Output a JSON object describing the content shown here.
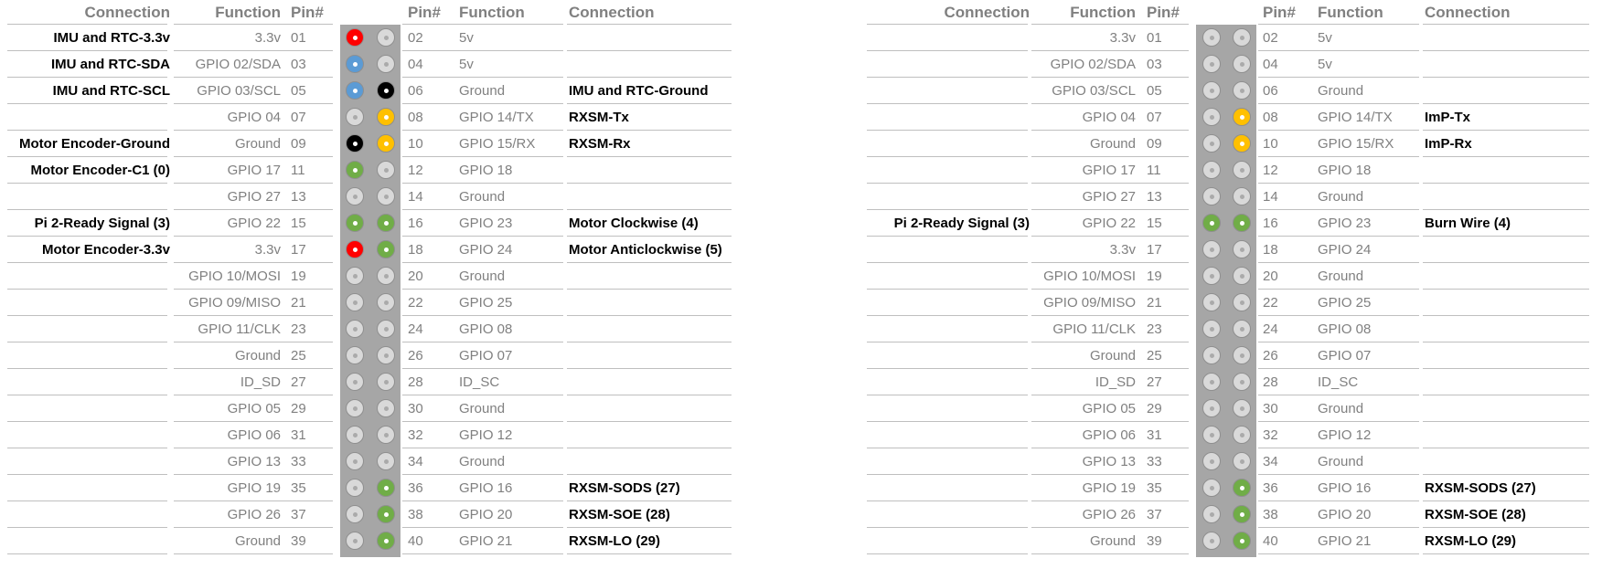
{
  "headers": {
    "connection": "Connection",
    "function": "Function",
    "pin": "Pin#"
  },
  "colors": {
    "white": "#d9d9d9",
    "red": "#ff0000",
    "blue": "#5b9bd5",
    "black": "#000000",
    "yellow": "#ffc000",
    "green": "#70ad47"
  },
  "left_panel": {
    "rows": [
      {
        "lconn": "IMU and RTC-3.3v",
        "lfunc": "3.3v",
        "lpin": "01",
        "lcolor": "red",
        "rcolor": "white",
        "rpin": "02",
        "rfunc": "5v",
        "rconn": ""
      },
      {
        "lconn": "IMU and RTC-SDA",
        "lfunc": "GPIO 02/SDA",
        "lpin": "03",
        "lcolor": "blue",
        "rcolor": "white",
        "rpin": "04",
        "rfunc": "5v",
        "rconn": ""
      },
      {
        "lconn": "IMU and RTC-SCL",
        "lfunc": "GPIO 03/SCL",
        "lpin": "05",
        "lcolor": "blue",
        "rcolor": "black",
        "rpin": "06",
        "rfunc": "Ground",
        "rconn": "IMU and RTC-Ground"
      },
      {
        "lconn": "",
        "lfunc": "GPIO 04",
        "lpin": "07",
        "lcolor": "white",
        "rcolor": "yellow",
        "rpin": "08",
        "rfunc": "GPIO 14/TX",
        "rconn": "RXSM-Tx"
      },
      {
        "lconn": "Motor Encoder-Ground",
        "lfunc": "Ground",
        "lpin": "09",
        "lcolor": "black",
        "rcolor": "yellow",
        "rpin": "10",
        "rfunc": "GPIO 15/RX",
        "rconn": "RXSM-Rx"
      },
      {
        "lconn": "Motor Encoder-C1 (0)",
        "lfunc": "GPIO 17",
        "lpin": "11",
        "lcolor": "green",
        "rcolor": "white",
        "rpin": "12",
        "rfunc": "GPIO 18",
        "rconn": ""
      },
      {
        "lconn": "",
        "lfunc": "GPIO 27",
        "lpin": "13",
        "lcolor": "white",
        "rcolor": "white",
        "rpin": "14",
        "rfunc": "Ground",
        "rconn": ""
      },
      {
        "lconn": "Pi 2-Ready Signal (3)",
        "lfunc": "GPIO 22",
        "lpin": "15",
        "lcolor": "green",
        "rcolor": "green",
        "rpin": "16",
        "rfunc": "GPIO 23",
        "rconn": "Motor Clockwise (4)"
      },
      {
        "lconn": "Motor Encoder-3.3v",
        "lfunc": "3.3v",
        "lpin": "17",
        "lcolor": "red",
        "rcolor": "green",
        "rpin": "18",
        "rfunc": "GPIO 24",
        "rconn": "Motor Anticlockwise (5)"
      },
      {
        "lconn": "",
        "lfunc": "GPIO 10/MOSI",
        "lpin": "19",
        "lcolor": "white",
        "rcolor": "white",
        "rpin": "20",
        "rfunc": "Ground",
        "rconn": ""
      },
      {
        "lconn": "",
        "lfunc": "GPIO 09/MISO",
        "lpin": "21",
        "lcolor": "white",
        "rcolor": "white",
        "rpin": "22",
        "rfunc": "GPIO 25",
        "rconn": ""
      },
      {
        "lconn": "",
        "lfunc": "GPIO 11/CLK",
        "lpin": "23",
        "lcolor": "white",
        "rcolor": "white",
        "rpin": "24",
        "rfunc": "GPIO 08",
        "rconn": ""
      },
      {
        "lconn": "",
        "lfunc": "Ground",
        "lpin": "25",
        "lcolor": "white",
        "rcolor": "white",
        "rpin": "26",
        "rfunc": "GPIO 07",
        "rconn": ""
      },
      {
        "lconn": "",
        "lfunc": "ID_SD",
        "lpin": "27",
        "lcolor": "white",
        "rcolor": "white",
        "rpin": "28",
        "rfunc": "ID_SC",
        "rconn": ""
      },
      {
        "lconn": "",
        "lfunc": "GPIO 05",
        "lpin": "29",
        "lcolor": "white",
        "rcolor": "white",
        "rpin": "30",
        "rfunc": "Ground",
        "rconn": ""
      },
      {
        "lconn": "",
        "lfunc": "GPIO 06",
        "lpin": "31",
        "lcolor": "white",
        "rcolor": "white",
        "rpin": "32",
        "rfunc": "GPIO 12",
        "rconn": ""
      },
      {
        "lconn": "",
        "lfunc": "GPIO 13",
        "lpin": "33",
        "lcolor": "white",
        "rcolor": "white",
        "rpin": "34",
        "rfunc": "Ground",
        "rconn": ""
      },
      {
        "lconn": "",
        "lfunc": "GPIO 19",
        "lpin": "35",
        "lcolor": "white",
        "rcolor": "green",
        "rpin": "36",
        "rfunc": "GPIO 16",
        "rconn": "RXSM-SODS (27)"
      },
      {
        "lconn": "",
        "lfunc": "GPIO 26",
        "lpin": "37",
        "lcolor": "white",
        "rcolor": "green",
        "rpin": "38",
        "rfunc": "GPIO 20",
        "rconn": "RXSM-SOE (28)"
      },
      {
        "lconn": "",
        "lfunc": "Ground",
        "lpin": "39",
        "lcolor": "white",
        "rcolor": "green",
        "rpin": "40",
        "rfunc": "GPIO 21",
        "rconn": "RXSM-LO (29)"
      }
    ]
  },
  "right_panel": {
    "rows": [
      {
        "lconn": "",
        "lfunc": "3.3v",
        "lpin": "01",
        "lcolor": "white",
        "rcolor": "white",
        "rpin": "02",
        "rfunc": "5v",
        "rconn": ""
      },
      {
        "lconn": "",
        "lfunc": "GPIO 02/SDA",
        "lpin": "03",
        "lcolor": "white",
        "rcolor": "white",
        "rpin": "04",
        "rfunc": "5v",
        "rconn": ""
      },
      {
        "lconn": "",
        "lfunc": "GPIO 03/SCL",
        "lpin": "05",
        "lcolor": "white",
        "rcolor": "white",
        "rpin": "06",
        "rfunc": "Ground",
        "rconn": ""
      },
      {
        "lconn": "",
        "lfunc": "GPIO 04",
        "lpin": "07",
        "lcolor": "white",
        "rcolor": "yellow",
        "rpin": "08",
        "rfunc": "GPIO 14/TX",
        "rconn": "ImP-Tx"
      },
      {
        "lconn": "",
        "lfunc": "Ground",
        "lpin": "09",
        "lcolor": "white",
        "rcolor": "yellow",
        "rpin": "10",
        "rfunc": "GPIO 15/RX",
        "rconn": "ImP-Rx"
      },
      {
        "lconn": "",
        "lfunc": "GPIO 17",
        "lpin": "11",
        "lcolor": "white",
        "rcolor": "white",
        "rpin": "12",
        "rfunc": "GPIO 18",
        "rconn": ""
      },
      {
        "lconn": "",
        "lfunc": "GPIO 27",
        "lpin": "13",
        "lcolor": "white",
        "rcolor": "white",
        "rpin": "14",
        "rfunc": "Ground",
        "rconn": ""
      },
      {
        "lconn": "Pi 2-Ready Signal (3)",
        "lfunc": "GPIO 22",
        "lpin": "15",
        "lcolor": "green",
        "rcolor": "green",
        "rpin": "16",
        "rfunc": "GPIO 23",
        "rconn": "Burn Wire (4)"
      },
      {
        "lconn": "",
        "lfunc": "3.3v",
        "lpin": "17",
        "lcolor": "white",
        "rcolor": "white",
        "rpin": "18",
        "rfunc": "GPIO 24",
        "rconn": ""
      },
      {
        "lconn": "",
        "lfunc": "GPIO 10/MOSI",
        "lpin": "19",
        "lcolor": "white",
        "rcolor": "white",
        "rpin": "20",
        "rfunc": "Ground",
        "rconn": ""
      },
      {
        "lconn": "",
        "lfunc": "GPIO 09/MISO",
        "lpin": "21",
        "lcolor": "white",
        "rcolor": "white",
        "rpin": "22",
        "rfunc": "GPIO 25",
        "rconn": ""
      },
      {
        "lconn": "",
        "lfunc": "GPIO 11/CLK",
        "lpin": "23",
        "lcolor": "white",
        "rcolor": "white",
        "rpin": "24",
        "rfunc": "GPIO 08",
        "rconn": ""
      },
      {
        "lconn": "",
        "lfunc": "Ground",
        "lpin": "25",
        "lcolor": "white",
        "rcolor": "white",
        "rpin": "26",
        "rfunc": "GPIO 07",
        "rconn": ""
      },
      {
        "lconn": "",
        "lfunc": "ID_SD",
        "lpin": "27",
        "lcolor": "white",
        "rcolor": "white",
        "rpin": "28",
        "rfunc": "ID_SC",
        "rconn": ""
      },
      {
        "lconn": "",
        "lfunc": "GPIO 05",
        "lpin": "29",
        "lcolor": "white",
        "rcolor": "white",
        "rpin": "30",
        "rfunc": "Ground",
        "rconn": ""
      },
      {
        "lconn": "",
        "lfunc": "GPIO 06",
        "lpin": "31",
        "lcolor": "white",
        "rcolor": "white",
        "rpin": "32",
        "rfunc": "GPIO 12",
        "rconn": ""
      },
      {
        "lconn": "",
        "lfunc": "GPIO 13",
        "lpin": "33",
        "lcolor": "white",
        "rcolor": "white",
        "rpin": "34",
        "rfunc": "Ground",
        "rconn": ""
      },
      {
        "lconn": "",
        "lfunc": "GPIO 19",
        "lpin": "35",
        "lcolor": "white",
        "rcolor": "green",
        "rpin": "36",
        "rfunc": "GPIO 16",
        "rconn": "RXSM-SODS (27)"
      },
      {
        "lconn": "",
        "lfunc": "GPIO 26",
        "lpin": "37",
        "lcolor": "white",
        "rcolor": "green",
        "rpin": "38",
        "rfunc": "GPIO 20",
        "rconn": "RXSM-SOE (28)"
      },
      {
        "lconn": "",
        "lfunc": "Ground",
        "lpin": "39",
        "lcolor": "white",
        "rcolor": "green",
        "rpin": "40",
        "rfunc": "GPIO 21",
        "rconn": "RXSM-LO (29)"
      }
    ]
  }
}
